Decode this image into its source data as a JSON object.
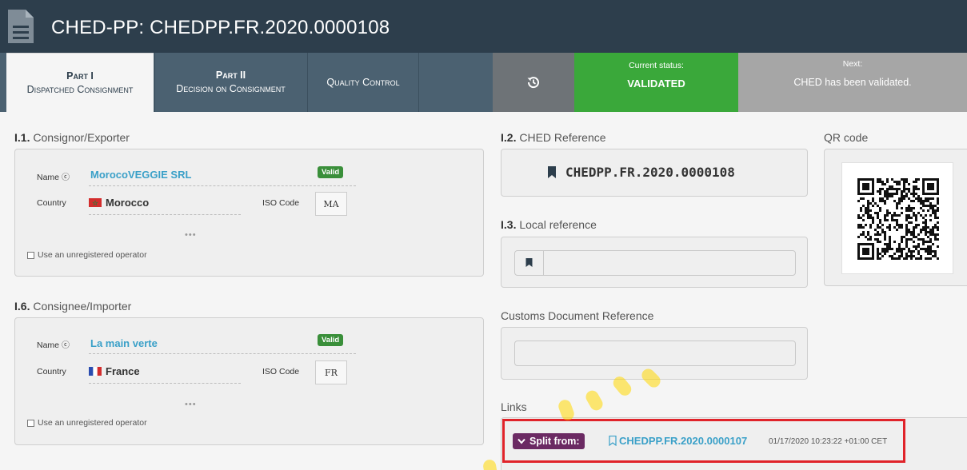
{
  "header": {
    "title": "CHED-PP: CHEDPP.FR.2020.0000108",
    "icon": "document-icon"
  },
  "tabs": {
    "part1": {
      "line1": "Part I",
      "line2": "Dispatched Consignment"
    },
    "part2": {
      "line1": "Part II",
      "line2": "Decision on Consignment"
    },
    "quality_control": "Quality Control",
    "history_icon": "history-icon"
  },
  "status": {
    "current_label": "Current status:",
    "current_value": "VALIDATED",
    "current_color": "#3aa83a",
    "next_label": "Next:",
    "next_value": "CHED has been validated."
  },
  "consignor": {
    "section_num": "I.1.",
    "section_title": "Consignor/Exporter",
    "name_label": "Name",
    "name_value": "MorocoVEGGIE SRL",
    "valid_badge": "Valid",
    "country_label": "Country",
    "country_value": "Morocco",
    "iso_label": "ISO Code",
    "iso_value": "MA",
    "ellipsis": "•••",
    "unregistered_label": "Use an unregistered operator"
  },
  "consignee": {
    "section_num": "I.6.",
    "section_title": "Consignee/Importer",
    "name_label": "Name",
    "name_value": "La main verte",
    "valid_badge": "Valid",
    "country_label": "Country",
    "country_value": "France",
    "iso_label": "ISO Code",
    "iso_value": "FR",
    "ellipsis": "•••",
    "unregistered_label": "Use an unregistered operator"
  },
  "ched_reference": {
    "section_num": "I.2.",
    "section_title": "CHED Reference",
    "value": "CHEDPP.FR.2020.0000108"
  },
  "local_reference": {
    "section_num": "I.3.",
    "section_title": "Local reference",
    "value": ""
  },
  "customs_reference": {
    "section_title": "Customs Document Reference",
    "value": ""
  },
  "qr": {
    "section_title": "QR code"
  },
  "links": {
    "section_title": "Links",
    "split_label": "Split from:",
    "split_ref": "CHEDPP.FR.2020.0000107",
    "split_date": "01/17/2020 10:23:22 +01:00 CET"
  }
}
